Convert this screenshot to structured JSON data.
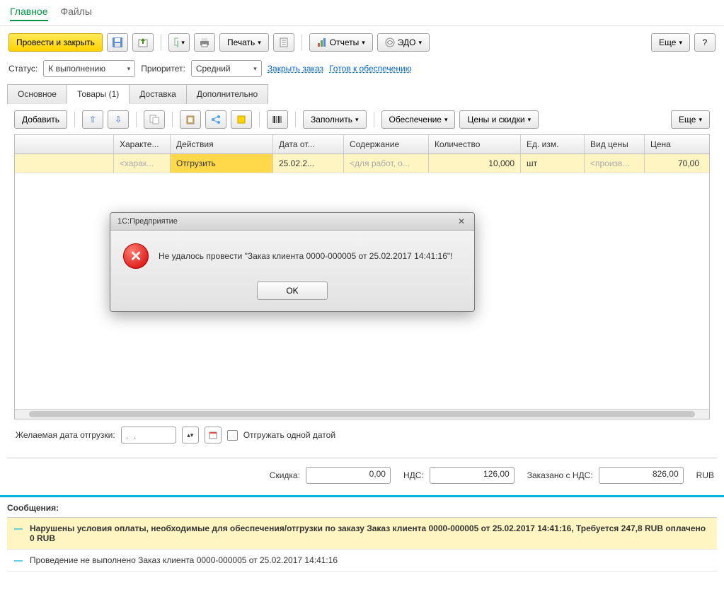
{
  "nav": {
    "main": "Главное",
    "files": "Файлы"
  },
  "toolbar": {
    "post_close": "Провести и закрыть",
    "print": "Печать",
    "reports": "Отчеты",
    "edo": "ЭДО",
    "more": "Еще",
    "help": "?"
  },
  "status": {
    "status_label": "Статус:",
    "status_value": "К выполнению",
    "priority_label": "Приоритет:",
    "priority_value": "Средний",
    "close_order": "Закрыть заказ",
    "ready_link": "Готов к обеспечению"
  },
  "subtabs": {
    "t0": "Основное",
    "t1": "Товары (1)",
    "t2": "Доставка",
    "t3": "Дополнительно"
  },
  "grid_tb": {
    "add": "Добавить",
    "fill": "Заполнить",
    "provision": "Обеспечение",
    "prices": "Цены и скидки",
    "more": "Еще"
  },
  "columns": {
    "c1": "Характе...",
    "c2": "Действия",
    "c3": "Дата от...",
    "c4": "Содержание",
    "c5": "Количество",
    "c6": "Ед. изм.",
    "c7": "Вид цены",
    "c8": "Цена"
  },
  "row": {
    "c1": "<харак...",
    "c2": "Отгрузить",
    "c3": "25.02.2...",
    "c4": "<для работ, о...",
    "c5": "10,000",
    "c6": "шт",
    "c7": "<произв...",
    "c8": "70,00"
  },
  "ship": {
    "label": "Желаемая дата отгрузки:",
    "placeholder": ".  .",
    "checkbox_label": "Отгружать одной датой"
  },
  "totals": {
    "discount_label": "Скидка:",
    "discount_val": "0,00",
    "vat_label": "НДС:",
    "vat_val": "126,00",
    "total_label": "Заказано с НДС:",
    "total_val": "826,00",
    "currency": "RUB"
  },
  "messages": {
    "title": "Сообщения:",
    "m1": "Нарушены условия оплаты, необходимые для обеспечения/отгрузки по заказу Заказ клиента 0000-000005 от 25.02.2017 14:41:16, Требуется 247,8 RUB оплачено 0 RUB",
    "m2": "Проведение не выполнено Заказ клиента 0000-000005 от 25.02.2017 14:41:16"
  },
  "modal": {
    "title": "1С:Предприятие",
    "text": "Не удалось провести \"Заказ клиента 0000-000005 от 25.02.2017 14:41:16\"!",
    "ok": "OK"
  }
}
